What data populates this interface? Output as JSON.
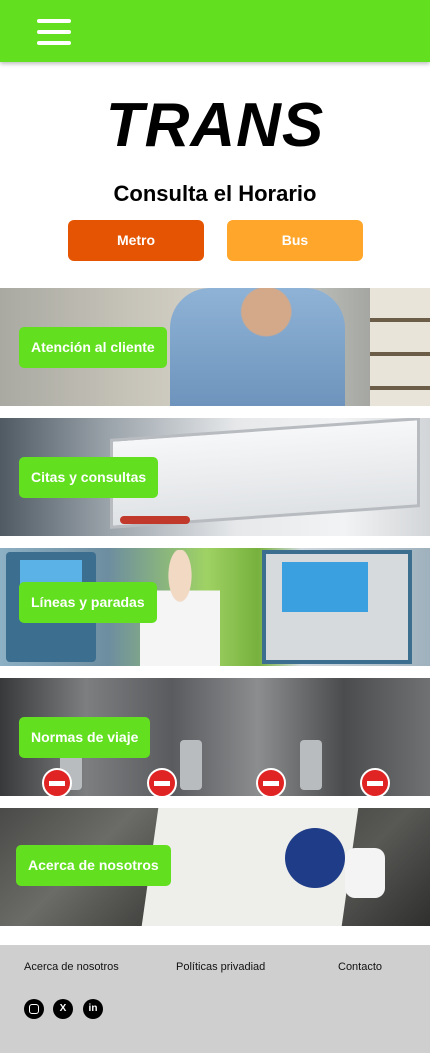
{
  "header": {
    "menu_icon": "hamburger-menu-icon",
    "color": "#62e01f"
  },
  "logo": "TRANS",
  "schedule": {
    "title": "Consulta el Horario",
    "metro_label": "Metro",
    "bus_label": "Bus",
    "metro_color": "#e45402",
    "bus_color": "#ffa62b"
  },
  "sections": [
    {
      "label": "Atención al cliente"
    },
    {
      "label": "Citas y consultas"
    },
    {
      "label": "Líneas y paradas"
    },
    {
      "label": "Normas de viaje"
    },
    {
      "label": "Acerca de nosotros"
    }
  ],
  "footer": {
    "links": [
      "Acerca de nosotros",
      "Políticas privadiad",
      "Contacto"
    ],
    "social": [
      {
        "icon": "instagram-icon"
      },
      {
        "icon": "x-twitter-icon"
      },
      {
        "icon": "linkedin-icon"
      }
    ]
  }
}
